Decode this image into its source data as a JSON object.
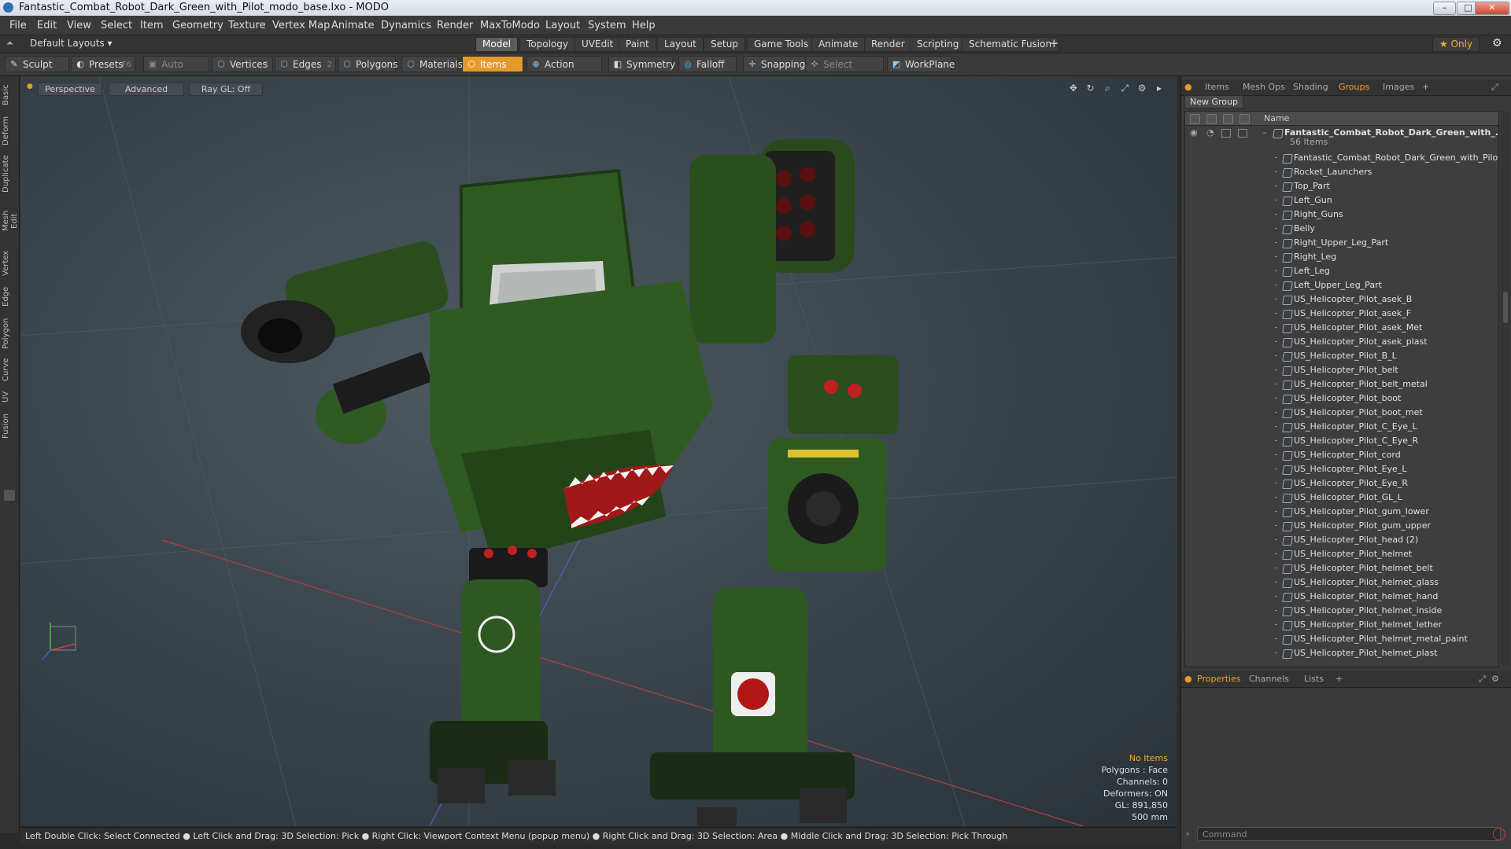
{
  "window": {
    "title": "Fantastic_Combat_Robot_Dark_Green_with_Pilot_modo_base.lxo - MODO",
    "controls": [
      "–",
      "□",
      "✕"
    ]
  },
  "menu": [
    "File",
    "Edit",
    "View",
    "Select",
    "Item",
    "Geometry",
    "Texture",
    "Vertex Map",
    "Animate",
    "Dynamics",
    "Render",
    "MaxToModo",
    "Layout",
    "System",
    "Help"
  ],
  "layout": {
    "preset": "Default Layouts ▾",
    "tabs": [
      "Model",
      "Topology",
      "UVEdit",
      "Paint",
      "Layout",
      "Setup",
      "Game Tools",
      "Animate",
      "Render",
      "Scripting",
      "Schematic Fusion"
    ],
    "active_tab": "Model",
    "add": "+",
    "only": "★  Only"
  },
  "toolbar": {
    "sculpt": "Sculpt",
    "presets": "Presets",
    "presets_key": "F6",
    "auto_select": "Auto Select",
    "vertices": "Vertices",
    "vertices_count": "1",
    "edges": "Edges",
    "edges_count": "2",
    "polygons": "Polygons",
    "materials": "Materials",
    "items": "Items",
    "action_center": "Action Center",
    "symmetry": "Symmetry",
    "falloff": "Falloff",
    "snapping": "Snapping",
    "select_through": "Select Through",
    "workplane": "WorkPlane"
  },
  "left_tabs": [
    "Basic",
    "Deform",
    "Duplicate",
    "Mesh Edit",
    "Vertex",
    "Edge",
    "Polygon",
    "Curve",
    "UV",
    "Fusion"
  ],
  "viewport": {
    "view": "Perspective",
    "shading": "Advanced",
    "raygl": "Ray GL: Off",
    "info": {
      "selection": "No Items",
      "polygons": "Polygons : Face",
      "channels": "Channels: 0",
      "deformers": "Deformers: ON",
      "gl": "GL: 891,850",
      "scale": "500 mm"
    }
  },
  "status": "Left Double Click: Select Connected ● Left Click and Drag: 3D Selection: Pick ● Right Click: Viewport Context Menu (popup menu) ● Right Click and Drag: 3D Selection: Area ● Middle Click and Drag: 3D Selection: Pick Through",
  "panel": {
    "tabs": [
      "Items",
      "Mesh Ops",
      "Shading",
      "Groups",
      "Images",
      "+"
    ],
    "active_tab": "Groups",
    "new_group": "New Group",
    "column_name": "Name",
    "root": "Fantastic_Combat_Robot_Dark_Green_with_...",
    "root_count": "56 Items",
    "items": [
      "Fantastic_Combat_Robot_Dark_Green_with_Pilot",
      "Rocket_Launchers",
      "Top_Part",
      "Left_Gun",
      "Right_Guns",
      "Belly",
      "Right_Upper_Leg_Part",
      "Right_Leg",
      "Left_Leg",
      "Left_Upper_Leg_Part",
      "US_Helicopter_Pilot_asek_B",
      "US_Helicopter_Pilot_asek_F",
      "US_Helicopter_Pilot_asek_Met",
      "US_Helicopter_Pilot_asek_plast",
      "US_Helicopter_Pilot_B_L",
      "US_Helicopter_Pilot_belt",
      "US_Helicopter_Pilot_belt_metal",
      "US_Helicopter_Pilot_boot",
      "US_Helicopter_Pilot_boot_met",
      "US_Helicopter_Pilot_C_Eye_L",
      "US_Helicopter_Pilot_C_Eye_R",
      "US_Helicopter_Pilot_cord",
      "US_Helicopter_Pilot_Eye_L",
      "US_Helicopter_Pilot_Eye_R",
      "US_Helicopter_Pilot_GL_L",
      "US_Helicopter_Pilot_gum_lower",
      "US_Helicopter_Pilot_gum_upper",
      "US_Helicopter_Pilot_head (2)",
      "US_Helicopter_Pilot_helmet",
      "US_Helicopter_Pilot_helmet_belt",
      "US_Helicopter_Pilot_helmet_glass",
      "US_Helicopter_Pilot_helmet_hand",
      "US_Helicopter_Pilot_helmet_inside",
      "US_Helicopter_Pilot_helmet_lether",
      "US_Helicopter_Pilot_helmet_metal_paint",
      "US_Helicopter_Pilot_helmet_plast"
    ],
    "bottom_tabs": [
      "Properties",
      "Channels",
      "Lists",
      "+"
    ],
    "bottom_active": "Properties",
    "command_placeholder": "Command"
  },
  "colors": {
    "accent": "#e49a2c",
    "robot_green": "#2f5a22",
    "dark_green": "#1e3a15"
  }
}
